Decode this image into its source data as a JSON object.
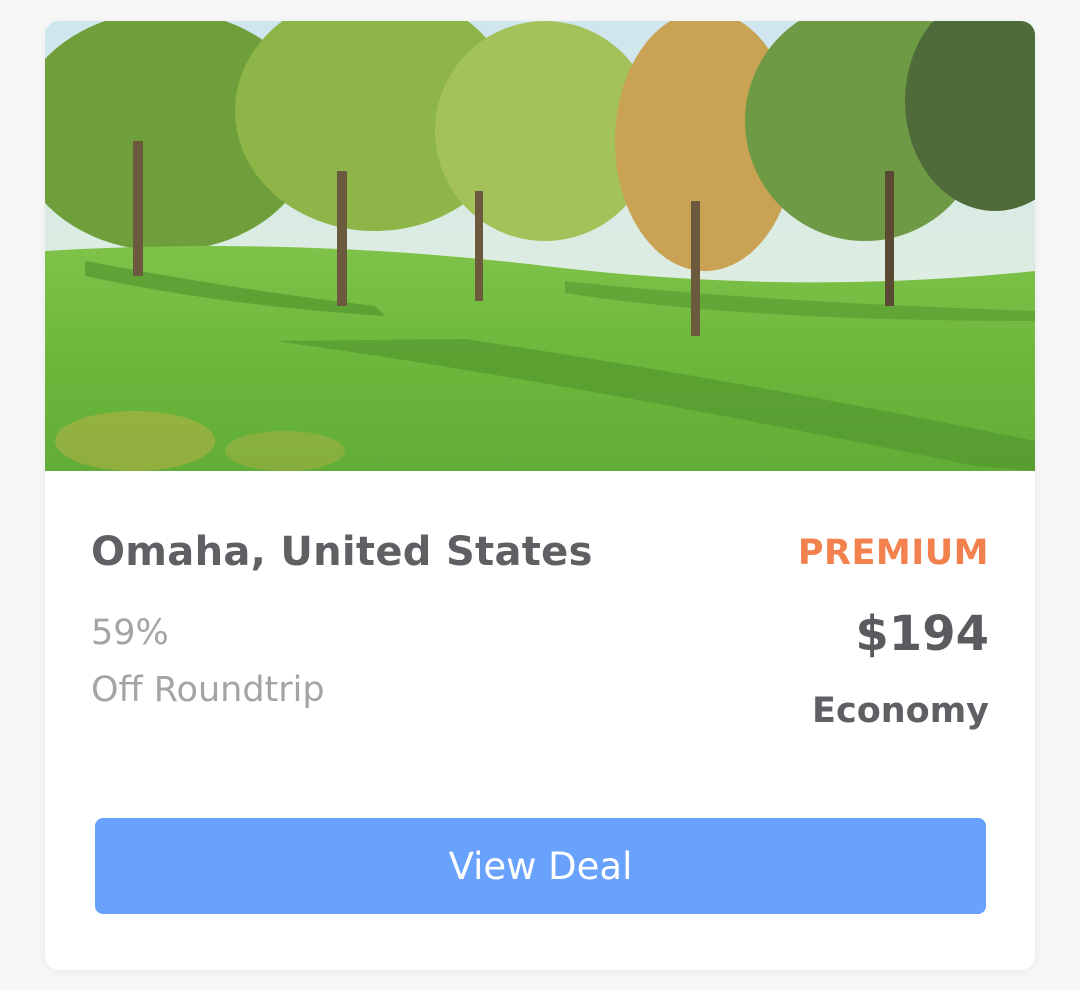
{
  "deal": {
    "destination": "Omaha, United States",
    "tier": "PREMIUM",
    "discount": "59%",
    "trip_type": "Off Roundtrip",
    "price": "$194",
    "cabin": "Economy",
    "cta_label": "View Deal"
  },
  "colors": {
    "tier": "#f2814d",
    "button": "#69a2fc",
    "title": "#5f6063",
    "muted": "#a2a4a8"
  },
  "hero_image": {
    "subject": "park-landscape"
  }
}
